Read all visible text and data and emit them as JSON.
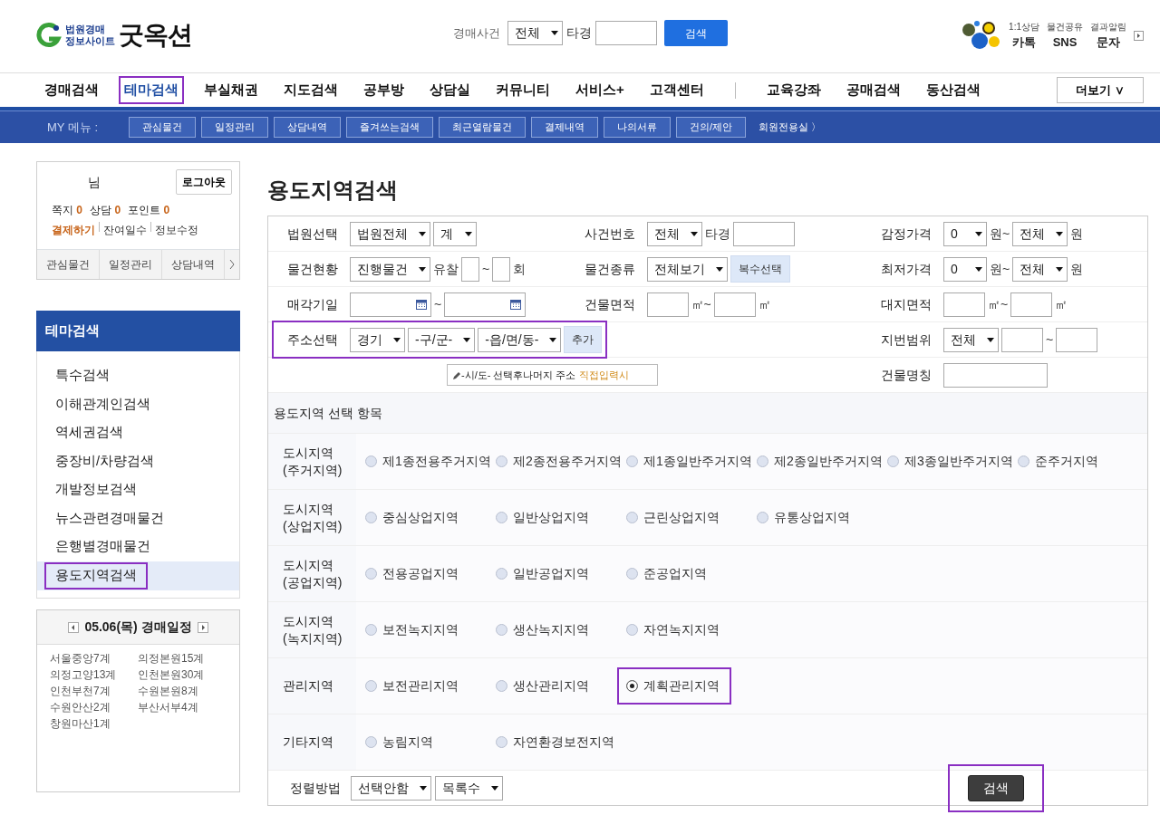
{
  "header": {
    "logo_lines": [
      "법원경매",
      "정보사이트"
    ],
    "logo_name": "굿옥션",
    "search": {
      "label": "경매사건",
      "select": "전체",
      "unit": "타경",
      "button": "검색"
    },
    "shortcuts": [
      {
        "caption": "1:1상담",
        "label": "카톡"
      },
      {
        "caption": "물건공유",
        "label": "SNS"
      },
      {
        "caption": "결과알림",
        "label": "문자"
      }
    ]
  },
  "main_nav": [
    {
      "label": "경매검색",
      "selected": false
    },
    {
      "label": "테마검색",
      "selected": true
    },
    {
      "label": "부실채권",
      "selected": false
    },
    {
      "label": "지도검색",
      "selected": false
    },
    {
      "label": "공부방",
      "selected": false
    },
    {
      "label": "상담실",
      "selected": false
    },
    {
      "label": "커뮤니티",
      "selected": false
    },
    {
      "label": "서비스+",
      "selected": false
    },
    {
      "label": "고객센터",
      "selected": false
    }
  ],
  "extra_nav": [
    "교육강좌",
    "공매검색",
    "동산검색"
  ],
  "more_button": "더보기 ∨",
  "my_menu": {
    "label": "MY 메뉴 :",
    "items": [
      "관심물건",
      "일정관리",
      "상담내역",
      "즐겨쓰는검색",
      "최근열람물건",
      "결제내역",
      "나의서류",
      "건의/제안"
    ],
    "member_link": "회원전용실 〉"
  },
  "user_box": {
    "suffix": "님",
    "logout": "로그아웃",
    "stats": [
      {
        "label": "쪽지",
        "value": "0"
      },
      {
        "label": "상담",
        "value": "0"
      },
      {
        "label": "포인트",
        "value": "0"
      }
    ],
    "links": [
      {
        "label": "결제하기",
        "emphasized": true
      },
      {
        "label": "잔여일수",
        "emphasized": false
      },
      {
        "label": "정보수정",
        "emphasized": false
      }
    ],
    "tabs": [
      "관심물건",
      "일정관리",
      "상담내역"
    ]
  },
  "theme_menu": {
    "title": "테마검색",
    "items": [
      {
        "label": "특수검색",
        "selected": false
      },
      {
        "label": "이해관계인검색",
        "selected": false
      },
      {
        "label": "역세권검색",
        "selected": false
      },
      {
        "label": "중장비/차량검색",
        "selected": false
      },
      {
        "label": "개발정보검색",
        "selected": false
      },
      {
        "label": "뉴스관련경매물건",
        "selected": false
      },
      {
        "label": "은행별경매물건",
        "selected": false
      },
      {
        "label": "용도지역검색",
        "selected": true
      }
    ]
  },
  "schedule": {
    "title": "05.06(목) 경매일정",
    "entries": [
      "서울중앙7계",
      "의정본원15계",
      "의정고양13계",
      "인천본원30계",
      "인천부천7계",
      "수원본원8계",
      "수원안산2계",
      "부산서부4계",
      "창원마산1계"
    ]
  },
  "page_title": "용도지역검색",
  "form_rows": [
    {
      "left": [
        {
          "label": "법원선택",
          "highlighted": false,
          "controls": [
            {
              "kind": "select",
              "value": "법원전체"
            },
            {
              "kind": "select",
              "value": "계"
            }
          ]
        },
        {
          "label": "사건번호",
          "highlighted": false,
          "controls": [
            {
              "kind": "select",
              "value": "전체"
            },
            {
              "kind": "text",
              "text": "타경"
            },
            {
              "kind": "case_input"
            }
          ]
        }
      ],
      "right": {
        "label": "감정가격",
        "controls": [
          {
            "kind": "select",
            "value": "0"
          },
          {
            "kind": "text",
            "text": "원~"
          },
          {
            "kind": "select",
            "value": "전체"
          },
          {
            "kind": "text",
            "text": "원"
          }
        ]
      }
    },
    {
      "left": [
        {
          "label": "물건현황",
          "highlighted": false,
          "controls": [
            {
              "kind": "select",
              "value": "진행물건"
            },
            {
              "kind": "text",
              "text": "유찰"
            },
            {
              "kind": "short_input"
            },
            {
              "kind": "text",
              "text": "~"
            },
            {
              "kind": "short_input"
            },
            {
              "kind": "text",
              "text": "회"
            }
          ]
        },
        {
          "label": "물건종류",
          "highlighted": false,
          "controls": [
            {
              "kind": "select",
              "value": "전체보기"
            },
            {
              "kind": "button",
              "label": "복수선택"
            }
          ]
        }
      ],
      "right": {
        "label": "최저가격",
        "controls": [
          {
            "kind": "select",
            "value": "0"
          },
          {
            "kind": "text",
            "text": "원~"
          },
          {
            "kind": "select",
            "value": "전체"
          },
          {
            "kind": "text",
            "text": "원"
          }
        ]
      }
    },
    {
      "left": [
        {
          "label": "매각기일",
          "highlighted": false,
          "controls": [
            {
              "kind": "date_input"
            },
            {
              "kind": "text",
              "text": "~"
            },
            {
              "kind": "date_input"
            }
          ]
        },
        {
          "label": "건물면적",
          "highlighted": false,
          "controls": [
            {
              "kind": "input"
            },
            {
              "kind": "text",
              "text": "㎡~"
            },
            {
              "kind": "input"
            },
            {
              "kind": "text",
              "text": "㎡"
            }
          ]
        }
      ],
      "right": {
        "label": "대지면적",
        "controls": [
          {
            "kind": "input"
          },
          {
            "kind": "text",
            "text": "㎡~"
          },
          {
            "kind": "input"
          },
          {
            "kind": "text",
            "text": "㎡"
          }
        ]
      }
    },
    {
      "left": [
        {
          "label": "주소선택",
          "highlighted": true,
          "controls": [
            {
              "kind": "select",
              "value": "경기"
            },
            {
              "kind": "select",
              "value": "-구/군-"
            },
            {
              "kind": "select",
              "value": "-읍/면/동-"
            },
            {
              "kind": "button",
              "label": "추가"
            }
          ]
        }
      ],
      "right": {
        "label": "지번범위",
        "controls": [
          {
            "kind": "select",
            "value": "전체"
          },
          {
            "kind": "input"
          },
          {
            "kind": "text",
            "text": "~"
          },
          {
            "kind": "input"
          }
        ]
      }
    },
    {
      "left": [
        {
          "controls": [
            {
              "kind": "note",
              "text": "-시/도- 선택후나머지 주소",
              "link": "직접입력시"
            }
          ]
        }
      ],
      "right": {
        "label": "건물명칭",
        "controls": [
          {
            "kind": "wide_input"
          }
        ]
      }
    }
  ],
  "zones": {
    "title": "용도지역 선택 항목",
    "groups": [
      {
        "label": "도시지역\n(주거지역)",
        "options": [
          {
            "label": "제1종전용주거지역",
            "selected": false,
            "highlighted": false
          },
          {
            "label": "제2종전용주거지역",
            "selected": false,
            "highlighted": false
          },
          {
            "label": "제1종일반주거지역",
            "selected": false,
            "highlighted": false
          },
          {
            "label": "제2종일반주거지역",
            "selected": false,
            "highlighted": false
          },
          {
            "label": "제3종일반주거지역",
            "selected": false,
            "highlighted": false
          },
          {
            "label": "준주거지역",
            "selected": false,
            "highlighted": false
          }
        ]
      },
      {
        "label": "도시지역\n(상업지역)",
        "options": [
          {
            "label": "중심상업지역",
            "selected": false,
            "highlighted": false
          },
          {
            "label": "일반상업지역",
            "selected": false,
            "highlighted": false
          },
          {
            "label": "근린상업지역",
            "selected": false,
            "highlighted": false
          },
          {
            "label": "유통상업지역",
            "selected": false,
            "highlighted": false
          }
        ]
      },
      {
        "label": "도시지역\n(공업지역)",
        "options": [
          {
            "label": "전용공업지역",
            "selected": false,
            "highlighted": false
          },
          {
            "label": "일반공업지역",
            "selected": false,
            "highlighted": false
          },
          {
            "label": "준공업지역",
            "selected": false,
            "highlighted": false
          }
        ]
      },
      {
        "label": "도시지역\n(녹지지역)",
        "options": [
          {
            "label": "보전녹지지역",
            "selected": false,
            "highlighted": false
          },
          {
            "label": "생산녹지지역",
            "selected": false,
            "highlighted": false
          },
          {
            "label": "자연녹지지역",
            "selected": false,
            "highlighted": false
          }
        ]
      },
      {
        "label": "관리지역",
        "options": [
          {
            "label": "보전관리지역",
            "selected": false,
            "highlighted": false
          },
          {
            "label": "생산관리지역",
            "selected": false,
            "highlighted": false
          },
          {
            "label": "계획관리지역",
            "selected": true,
            "highlighted": true
          }
        ]
      },
      {
        "label": "기타지역",
        "options": [
          {
            "label": "농림지역",
            "selected": false,
            "highlighted": false
          },
          {
            "label": "자연환경보전지역",
            "selected": false,
            "highlighted": false
          }
        ]
      }
    ]
  },
  "sort": {
    "label": "정렬방법",
    "selects": [
      "선택안함",
      "목록수"
    ],
    "button": "검색",
    "button_highlighted": true
  }
}
